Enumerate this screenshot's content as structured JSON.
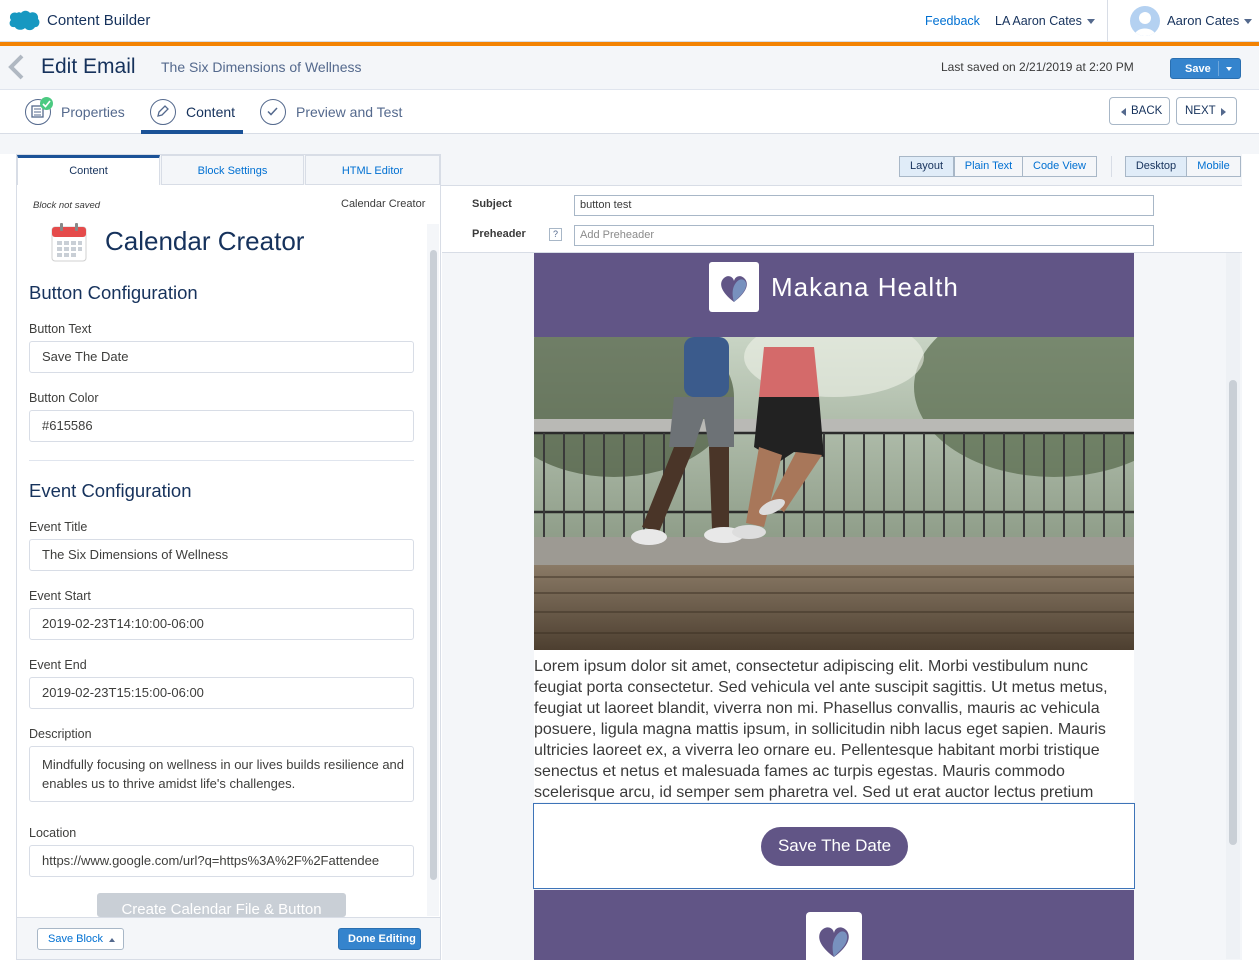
{
  "topbar": {
    "app_name": "Content Builder",
    "feedback": "Feedback",
    "business_unit": "LA Aaron Cates",
    "user_name": "Aaron Cates"
  },
  "header": {
    "title": "Edit Email",
    "email_name": "The Six Dimensions of Wellness",
    "last_saved": "Last saved on 2/21/2019 at 2:20 PM",
    "save_label": "Save"
  },
  "steps": [
    {
      "label": "Properties"
    },
    {
      "label": "Content"
    },
    {
      "label": "Preview and Test"
    }
  ],
  "nav": {
    "back": "BACK",
    "next": "NEXT"
  },
  "left_panel": {
    "tabs": [
      "Content",
      "Block Settings",
      "HTML Editor"
    ],
    "block_status": "Block not saved",
    "block_type": "Calendar Creator",
    "title": "Calendar Creator",
    "button_section": "Button Configuration",
    "button_text_label": "Button Text",
    "button_text_value": "Save The Date",
    "button_color_label": "Button Color",
    "button_color_value": "#615586",
    "event_section": "Event Configuration",
    "event_title_label": "Event Title",
    "event_title_value": "The Six Dimensions of Wellness",
    "event_start_label": "Event Start",
    "event_start_value": "2019-02-23T14:10:00-06:00",
    "event_end_label": "Event End",
    "event_end_value": "2019-02-23T15:15:00-06:00",
    "description_label": "Description",
    "description_value": "Mindfully focusing on wellness in our lives builds resilience and enables us to thrive amidst life's challenges.",
    "location_label": "Location",
    "location_value": "https://www.google.com/url?q=https%3A%2F%2Fattendee",
    "create_button": "Create Calendar File & Button",
    "save_block": "Save Block",
    "done_editing": "Done Editing"
  },
  "right_panel": {
    "view_tabs": [
      "Layout",
      "Plain Text",
      "Code View"
    ],
    "device_tabs": [
      "Desktop",
      "Mobile"
    ],
    "subject_label": "Subject",
    "subject_value": "button test",
    "preheader_label": "Preheader",
    "preheader_help": "?",
    "preheader_placeholder": "Add Preheader"
  },
  "email": {
    "brand": "Makana Health",
    "body": "Lorem ipsum dolor sit amet, consectetur adipiscing elit. Morbi vestibulum nunc feugiat porta consectetur. Sed vehicula vel ante suscipit sagittis. Ut metus metus, feugiat ut laoreet blandit, viverra non mi. Phasellus convallis, mauris ac vehicula posuere, ligula magna mattis ipsum, in sollicitudin nibh lacus eget sapien. Mauris ultricies laoreet ex, a viverra leo ornare eu. Pellentesque habitant morbi tristique senectus et netus et malesuada fames ac turpis egestas. Mauris commodo scelerisque arcu, id semper sem pharetra vel. Sed ut erat auctor lectus pretium",
    "button_label": "Save The Date"
  },
  "colors": {
    "brand_purple": "#615586",
    "accent_orange": "#f38303",
    "primary_blue": "#3584cd"
  },
  "icons": [
    "salesforce-cloud-icon",
    "chevron-down-icon",
    "user-avatar-icon",
    "back-chevron-icon",
    "properties-icon",
    "pencil-icon",
    "check-icon",
    "calendar-icon",
    "help-icon",
    "heart-logo-icon"
  ]
}
